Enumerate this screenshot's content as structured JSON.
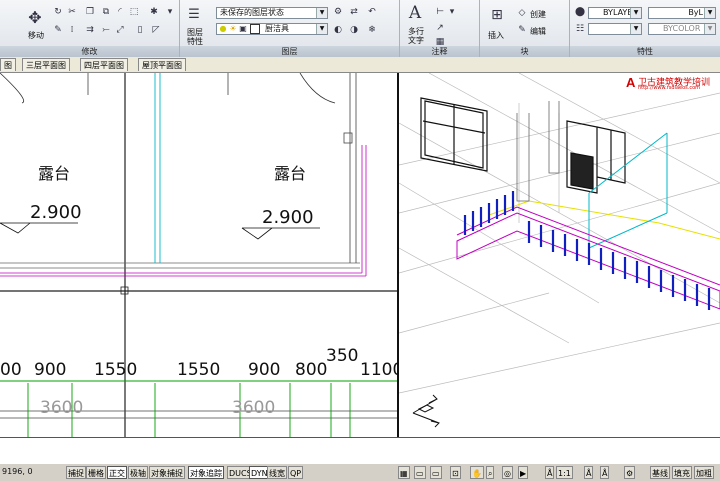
{
  "ribbon": {
    "modify": {
      "title": "修改",
      "move_label": "移动"
    },
    "layers": {
      "title": "图层",
      "layer_props_label1": "图层",
      "layer_props_label2": "特性",
      "state_combo": "未保存的图层状态",
      "layer_combo": "厨洁具"
    },
    "annotation": {
      "title": "注释",
      "mtext_label1": "多行",
      "mtext_label2": "文字"
    },
    "block": {
      "title": "块",
      "insert_label": "插入",
      "create_label": "创建",
      "edit_label": "编辑"
    },
    "properties": {
      "title": "特性",
      "color_combo": "BYLAYE",
      "linetype_combo": "ByL",
      "lineweight_combo": "BYCOLOR"
    }
  },
  "tabs": [
    "图",
    "三层平面图",
    "四层平面图",
    "屋顶平面图"
  ],
  "plan": {
    "room_label_left": "露台",
    "room_label_right": "露台",
    "elev_left": "2.900",
    "elev_right": "2.900",
    "dims_row": [
      "00",
      "900",
      "1550",
      "1550",
      "900",
      "800",
      "350",
      "1100"
    ],
    "dims_total": [
      "3600",
      "3600"
    ]
  },
  "watermark": {
    "text": "卫古建筑教学培训",
    "url": "http://www.rsdiaeos.com"
  },
  "cmd_lines": [
    "",
    ""
  ],
  "status": {
    "coords": "9196, 0",
    "toggles": [
      "捕捉",
      "栅格",
      "正交",
      "极轴",
      "对象捕捉",
      "对象追踪",
      "DUCS",
      "DYN",
      "线宽",
      "QP"
    ],
    "toggles_on": [
      false,
      false,
      true,
      false,
      false,
      true,
      false,
      true,
      false,
      false
    ],
    "scale": "1:1",
    "right_buttons": [
      "基线",
      "填充",
      "加粗"
    ]
  },
  "colors": {
    "green": "#00a000",
    "magenta": "#c000c0",
    "cyan": "#00b8c8",
    "blue": "#1020c0",
    "yellow": "#e8e000"
  }
}
